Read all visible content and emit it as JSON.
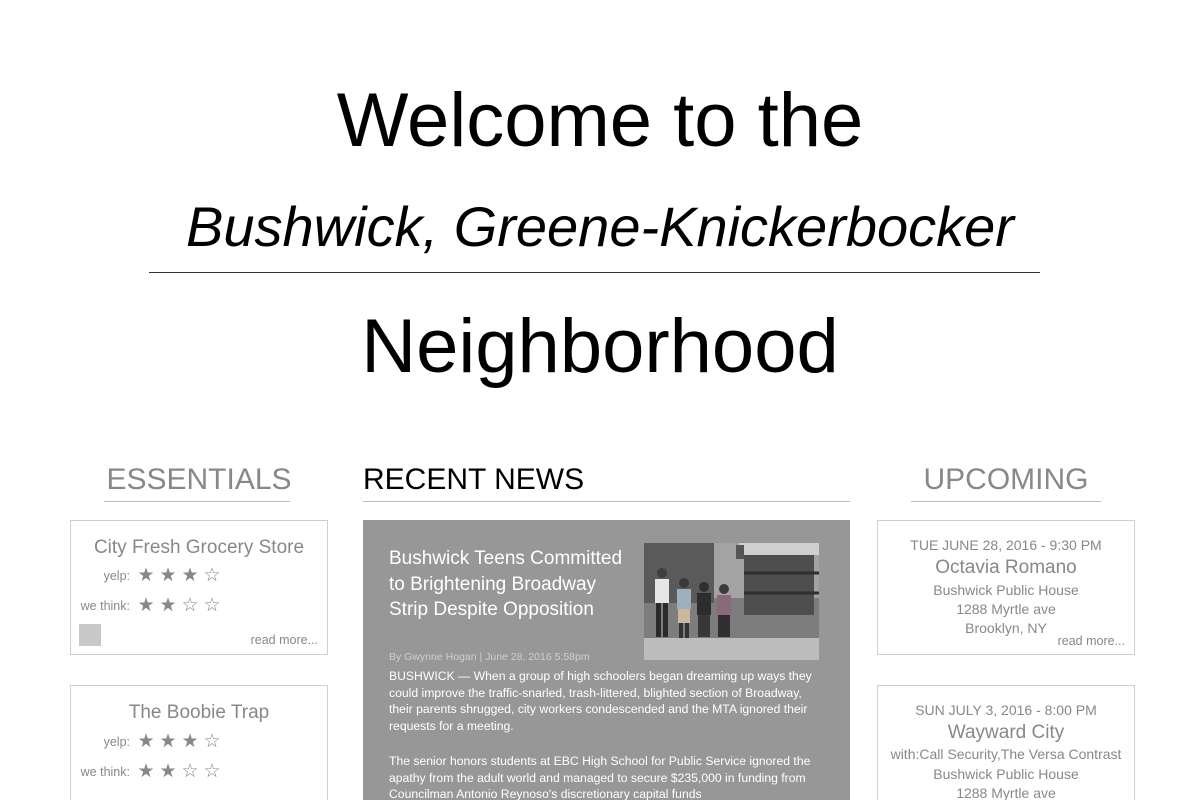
{
  "hero": {
    "line1": "Welcome to the",
    "line2": "Bushwick, Greene-Knickerbocker",
    "line3": "Neighborhood"
  },
  "essentials": {
    "heading": "ESSENTIALS",
    "cards": [
      {
        "name": "City Fresh Grocery Store",
        "yelp_label": "yelp:",
        "yelp_stars": 3,
        "we_think_label": "we think:",
        "we_think_stars": 2,
        "read_more": "read more..."
      },
      {
        "name": "The Boobie Trap",
        "yelp_label": "yelp:",
        "yelp_stars": 3,
        "we_think_label": "we think:",
        "we_think_stars": 2
      }
    ]
  },
  "news": {
    "heading": "RECENT NEWS",
    "article": {
      "title": "Bushwick Teens Committed to Brightening Broadway Strip Despite Opposition",
      "byline": "By Gwynne Hogan | June 28, 2016 5:58pm",
      "paragraph1": "BUSHWICK — When a group of high schoolers began dreaming up ways they could improve the traffic-snarled, trash-littered, blighted section of Broadway, their parents shrugged, city workers condescended and the MTA ignored their requests for a meeting.",
      "paragraph2": "The senior honors students at EBC High School for Public Service ignored the apathy from the adult world and managed to secure $235,000 in funding from Councilman Antonio Reynoso's discretionary capital funds"
    }
  },
  "upcoming": {
    "heading": "UPCOMING",
    "events": [
      {
        "date": "TUE JUNE 28, 2016 - 9:30 PM",
        "name": "Octavia Romano",
        "venue": "Bushwick Public House",
        "address": "1288 Myrtle ave",
        "city": "Brooklyn, NY",
        "read_more": "read more..."
      },
      {
        "date": "SUN JULY 3, 2016 - 8:00 PM",
        "name": "Wayward City",
        "with": "with:Call Security,The Versa Contrast",
        "venue": "Bushwick Public House",
        "address": "1288 Myrtle ave"
      }
    ]
  },
  "icons": {
    "star_filled": "star-icon",
    "star_empty": "star-outline-icon"
  },
  "colors": {
    "news_card_bg": "#979797",
    "muted_text": "#888888",
    "card_border": "#cfcfcf"
  }
}
